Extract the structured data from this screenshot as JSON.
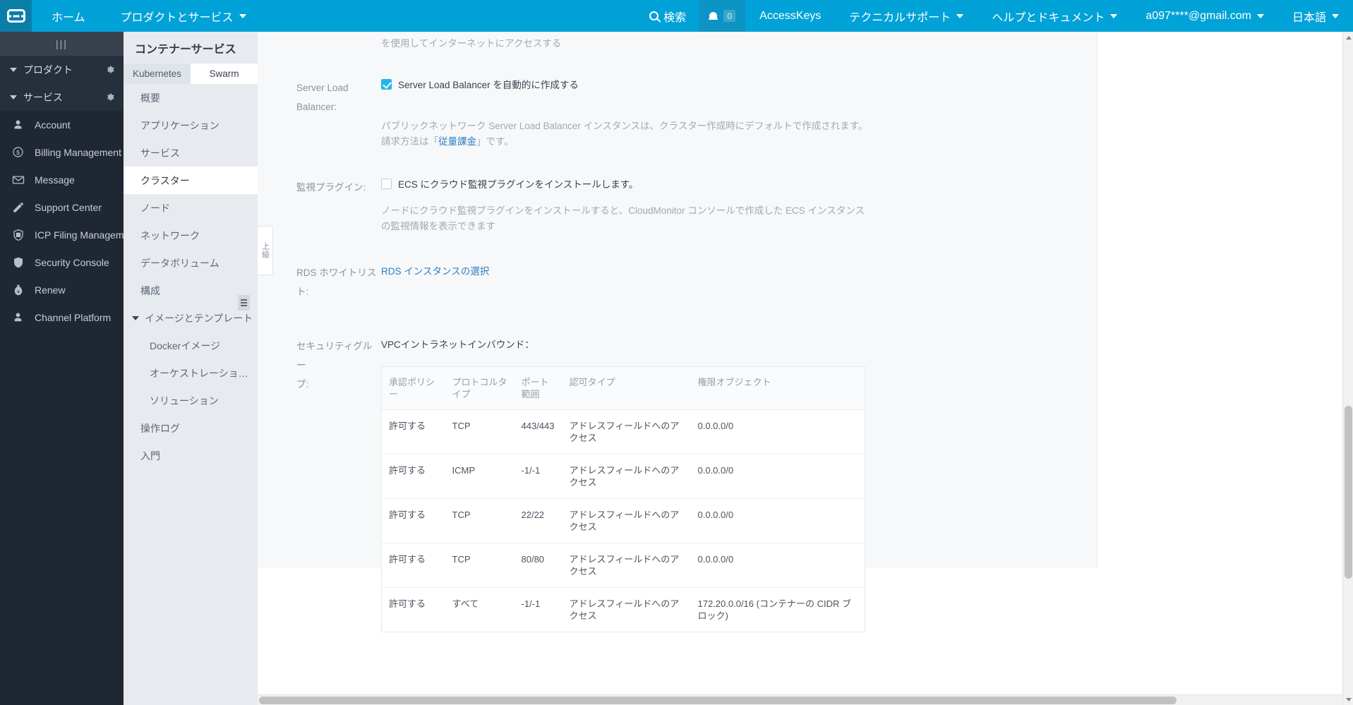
{
  "topbar": {
    "logo_name": "alibaba-cloud-logo",
    "home": "ホーム",
    "products": "プロダクトとサービス",
    "search": "検索",
    "badge_count": "0",
    "access_keys": "AccessKeys",
    "tech_support": "テクニカルサポート",
    "help_docs": "ヘルプとドキュメント",
    "account": "a097****@gmail.com",
    "language": "日本語"
  },
  "sidebar": {
    "handle": "|||",
    "groups": [
      {
        "label": "プロダクト"
      },
      {
        "label": "サービス"
      }
    ],
    "items": [
      {
        "label": "Account",
        "icon": "user-icon"
      },
      {
        "label": "Billing Management",
        "icon": "dollar-circle-icon"
      },
      {
        "label": "Message",
        "icon": "envelope-icon"
      },
      {
        "label": "Support Center",
        "icon": "pencil-icon"
      },
      {
        "label": "ICP Filing Managem…",
        "icon": "shield-seal-icon"
      },
      {
        "label": "Security Console",
        "icon": "shield-icon"
      },
      {
        "label": "Renew",
        "icon": "money-bag-icon"
      },
      {
        "label": "Channel Platform",
        "icon": "person-badge-icon"
      }
    ]
  },
  "subnav": {
    "title": "コンテナーサービス",
    "tabs": [
      {
        "label": "Kubernetes",
        "active": false
      },
      {
        "label": "Swarm",
        "active": true
      }
    ],
    "items": [
      {
        "label": "概要",
        "level": 1,
        "active": false
      },
      {
        "label": "アプリケーション",
        "level": 1,
        "active": false
      },
      {
        "label": "サービス",
        "level": 1,
        "active": false
      },
      {
        "label": "クラスター",
        "level": 1,
        "active": true
      },
      {
        "label": "ノード",
        "level": 1,
        "active": false
      },
      {
        "label": "ネットワーク",
        "level": 1,
        "active": false
      },
      {
        "label": "データボリューム",
        "level": 1,
        "active": false
      },
      {
        "label": "構成",
        "level": 1,
        "active": false
      },
      {
        "label": "イメージとテンプレート",
        "level": 0,
        "active": false
      },
      {
        "label": "Dockerイメージ",
        "level": 2,
        "active": false
      },
      {
        "label": "オーケストレーショ…",
        "level": 2,
        "active": false
      },
      {
        "label": "ソリューション",
        "level": 2,
        "active": false
      },
      {
        "label": "操作ログ",
        "level": 1,
        "active": false
      },
      {
        "label": "入門",
        "level": 1,
        "active": false
      }
    ],
    "advanced_tab": "上級"
  },
  "form": {
    "top_partial_text": "を使用してインターネットにアクセスする",
    "slb": {
      "label_line1": "Server Load",
      "label_line2": "Balancer:",
      "checkbox_label": "Server Load Balancer を自動的に作成する",
      "checked": true,
      "help_prefix": "パブリックネットワーク Server Load Balancer インスタンスは、クラスター作成時にデフォルトで作成されます。請求方法は「",
      "help_link": "従量課金",
      "help_suffix": "」です。"
    },
    "monitor": {
      "label": "監視プラグイン:",
      "checkbox_label": "ECS にクラウド監視プラグインをインストールします。",
      "checked": false,
      "help": "ノードにクラウド監視プラグインをインストールすると、CloudMonitor コンソールで作成した ECS インスタンスの監視情報を表示できます"
    },
    "rds": {
      "label_line1": "RDS ホワイトリス",
      "label_line2": "ト:",
      "link": "RDS インスタンスの選択"
    },
    "security_group": {
      "label_line1": "セキュリティグルー",
      "label_line2": "プ:",
      "subtitle": "VPCイントラネットインバウンド：",
      "columns": [
        "承認ポリシー",
        "プロトコルタイプ",
        "ポート範囲",
        "認可タイプ",
        "権限オブジェクト"
      ],
      "rows": [
        [
          "許可する",
          "TCP",
          "443/443",
          "アドレスフィールドへのアクセス",
          "0.0.0.0/0"
        ],
        [
          "許可する",
          "ICMP",
          "-1/-1",
          "アドレスフィールドへのアクセス",
          "0.0.0.0/0"
        ],
        [
          "許可する",
          "TCP",
          "22/22",
          "アドレスフィールドへのアクセス",
          "0.0.0.0/0"
        ],
        [
          "許可する",
          "TCP",
          "80/80",
          "アドレスフィールドへのアクセス",
          "0.0.0.0/0"
        ],
        [
          "許可する",
          "すべて",
          "-1/-1",
          "アドレスフィールドへのアクセス",
          "172.20.0.0/16 (コンテナーの CIDR ブロック)"
        ]
      ]
    }
  },
  "colors": {
    "brand": "#00a2d7",
    "accent_checkbox": "#25b6e8",
    "link": "#2b7fc4",
    "sidebar_bg": "#1f2733",
    "subnav_bg": "#e7ebef"
  }
}
